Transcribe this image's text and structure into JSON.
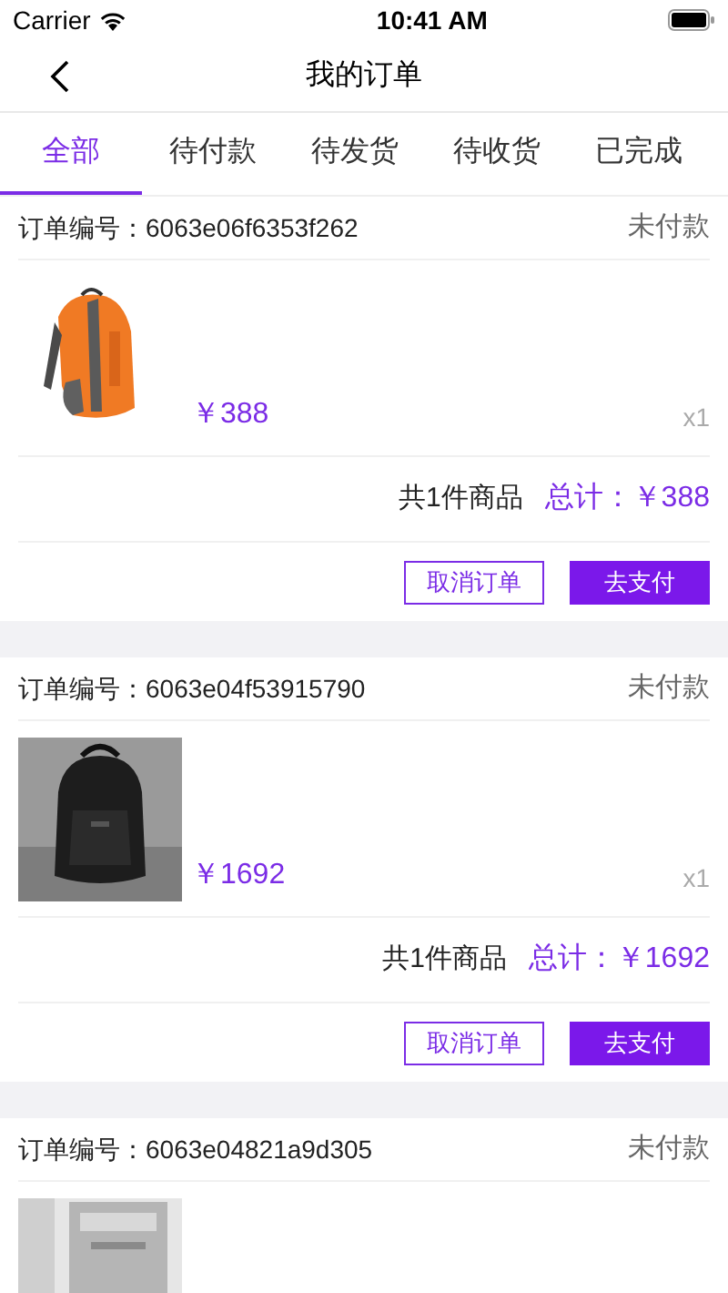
{
  "status_bar": {
    "carrier": "Carrier",
    "time": "10:41 AM"
  },
  "nav": {
    "title": "我的订单"
  },
  "tabs": [
    {
      "label": "全部",
      "selected": true
    },
    {
      "label": "待付款",
      "selected": false
    },
    {
      "label": "待发货",
      "selected": false
    },
    {
      "label": "待收货",
      "selected": false
    },
    {
      "label": "已完成",
      "selected": false
    }
  ],
  "orders": [
    {
      "number_label": "订单编号：",
      "number": "6063e06f6353f262",
      "status": "未付款",
      "items": [
        {
          "kind": "picture",
          "price": "￥388",
          "quantity": "x1"
        }
      ],
      "summary": "共1件商品",
      "total_label": "总计：",
      "total": "￥388",
      "buttons": [
        "取消订单",
        "去支付"
      ]
    },
    {
      "number_label": "订单编号：",
      "number": "6063e04f53915790",
      "status": "未付款",
      "items": [
        {
          "kind": "picture",
          "price": "￥1692",
          "quantity": "x1"
        }
      ],
      "summary": "共1件商品",
      "total_label": "总计：",
      "total": "￥1692",
      "buttons": [
        "取消订单",
        "去支付"
      ]
    },
    {
      "number_label": "订单编号：",
      "number": "6063e04821a9d305",
      "status": "未付款"
    }
  ]
}
